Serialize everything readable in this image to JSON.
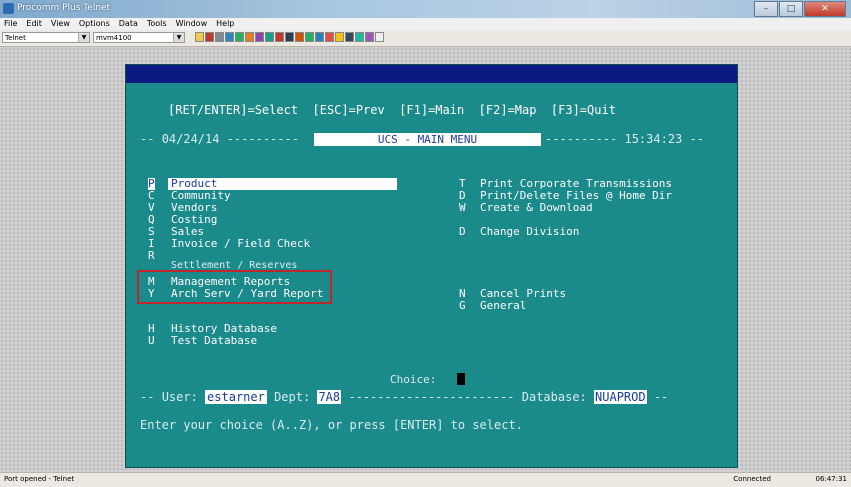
{
  "window": {
    "title": "Procomm Plus Telnet",
    "btn_min": "–",
    "btn_max": "□",
    "btn_close": "✕"
  },
  "menubar": [
    "File",
    "Edit",
    "View",
    "Options",
    "Data",
    "Tools",
    "Window",
    "Help"
  ],
  "toolbar": {
    "connection": "Telnet",
    "terminal": "mvm4100"
  },
  "terminal": {
    "keys_line": "[RET/ENTER]=Select  [ESC]=Prev  [F1]=Main  [F2]=Map  [F3]=Quit",
    "date": "04/24/14",
    "header_title": "UCS  - MAIN MENU",
    "time": "15:34:23",
    "left_menu": [
      {
        "key": "P",
        "label": "Product"
      },
      {
        "key": "C",
        "label": "Community"
      },
      {
        "key": "V",
        "label": "Vendors"
      },
      {
        "key": "Q",
        "label": "Costing"
      },
      {
        "key": "S",
        "label": "Sales"
      },
      {
        "key": "I",
        "label": "Invoice / Field Check"
      },
      {
        "key": "R",
        "label": "Settlement / Reserves"
      },
      {
        "key": "M",
        "label": "Management Reports"
      },
      {
        "key": "Y",
        "label": "Arch Serv / Yard Report"
      },
      {
        "key": "H",
        "label": "History Database"
      },
      {
        "key": "U",
        "label": "Test Database"
      }
    ],
    "right_menu": [
      {
        "key": "T",
        "label": "Print Corporate Transmissions"
      },
      {
        "key": "D",
        "label": "Print/Delete Files @ Home Dir"
      },
      {
        "key": "W",
        "label": "Create & Download"
      },
      {
        "key": "D",
        "label": "Change Division"
      },
      {
        "key": "N",
        "label": "Cancel Prints"
      },
      {
        "key": "G",
        "label": "General"
      }
    ],
    "choice_label": "Choice:",
    "user_label": "User:",
    "user_value": "estarner",
    "dept_label": "Dept:",
    "dept_value": "7A8",
    "database_label": "Database:",
    "database_value": "NUAPROD",
    "prompt": "Enter your choice (A..Z), or press [ENTER] to select."
  },
  "statusbar": {
    "left": "Port opened - Telnet",
    "right": "Connected",
    "time": "06:47:31"
  },
  "colors": {
    "terminal_bg": "#1a8a8a",
    "terminal_top": "#0a1a80",
    "highlight_box": "#c0272d",
    "field_text": "#1a3c9c"
  }
}
